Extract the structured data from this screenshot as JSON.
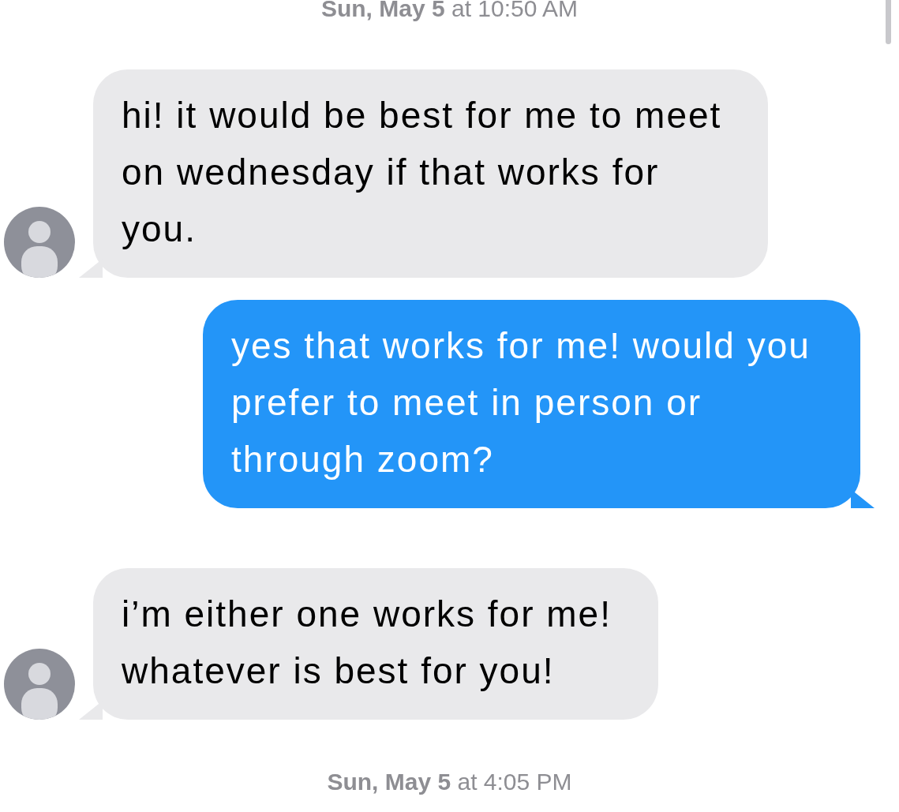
{
  "items": [
    {
      "kind": "timestamp",
      "text": "**Sun, May 5** at 10:50 AM"
    },
    {
      "kind": "incoming",
      "text": "hi! it would be best for me to meet on wednesday if that works for you.",
      "avatar": true
    },
    {
      "kind": "outgoing",
      "text": "yes that works for me! would you prefer to meet in person or through zoom?",
      "avatar": false
    },
    {
      "kind": "incoming",
      "text": "i’m either one works for me! whatever is best for you!",
      "avatar": true
    },
    {
      "kind": "timestamp",
      "text": "**Sun, May 5** at 4:05 PM"
    }
  ]
}
